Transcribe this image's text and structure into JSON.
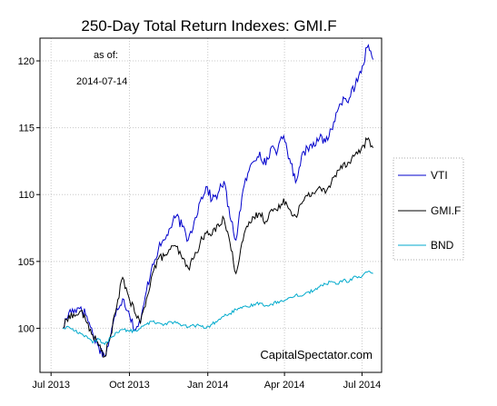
{
  "chart_data": {
    "type": "line",
    "title": "250-Day Total Return Indexes: GMI.F",
    "annotation_label": "as of:",
    "annotation_date": "2014-07-14",
    "source": "CapitalSpectator.com",
    "xlabel": "",
    "ylabel": "",
    "x_ticks": [
      {
        "label": "Jul 2013",
        "date": "2013-07-01"
      },
      {
        "label": "Oct 2013",
        "date": "2013-10-01"
      },
      {
        "label": "Jan 2014",
        "date": "2014-01-01"
      },
      {
        "label": "Apr 2014",
        "date": "2014-04-01"
      },
      {
        "label": "Jul 2014",
        "date": "2014-07-01"
      }
    ],
    "xlim": [
      "2013-06-18",
      "2014-07-24"
    ],
    "y_ticks": [
      100,
      105,
      110,
      115,
      120
    ],
    "ylim": [
      96.7,
      121.7
    ],
    "grid": true,
    "legend_position": "right",
    "series": [
      {
        "name": "VTI",
        "color": "#0000cc",
        "points": [
          [
            "2013-07-15",
            100.0
          ],
          [
            "2013-07-22",
            101.2
          ],
          [
            "2013-07-29",
            101.4
          ],
          [
            "2013-08-05",
            101.6
          ],
          [
            "2013-08-12",
            100.9
          ],
          [
            "2013-08-19",
            99.6
          ],
          [
            "2013-08-26",
            98.6
          ],
          [
            "2013-09-02",
            97.9
          ],
          [
            "2013-09-09",
            99.4
          ],
          [
            "2013-09-16",
            101.5
          ],
          [
            "2013-09-23",
            102.2
          ],
          [
            "2013-09-30",
            101.3
          ],
          [
            "2013-10-07",
            99.9
          ],
          [
            "2013-10-14",
            100.4
          ],
          [
            "2013-10-21",
            102.8
          ],
          [
            "2013-10-28",
            104.8
          ],
          [
            "2013-11-04",
            105.9
          ],
          [
            "2013-11-11",
            106.6
          ],
          [
            "2013-11-18",
            107.5
          ],
          [
            "2013-11-25",
            108.4
          ],
          [
            "2013-12-02",
            107.6
          ],
          [
            "2013-12-09",
            106.6
          ],
          [
            "2013-12-16",
            108.0
          ],
          [
            "2013-12-23",
            109.5
          ],
          [
            "2013-12-30",
            110.6
          ],
          [
            "2014-01-06",
            109.6
          ],
          [
            "2014-01-13",
            110.1
          ],
          [
            "2014-01-20",
            111.0
          ],
          [
            "2014-01-27",
            108.3
          ],
          [
            "2014-02-03",
            106.6
          ],
          [
            "2014-02-10",
            109.8
          ],
          [
            "2014-02-17",
            111.6
          ],
          [
            "2014-02-24",
            112.5
          ],
          [
            "2014-03-03",
            113.2
          ],
          [
            "2014-03-10",
            112.2
          ],
          [
            "2014-03-17",
            113.6
          ],
          [
            "2014-03-24",
            113.3
          ],
          [
            "2014-03-31",
            114.4
          ],
          [
            "2014-04-07",
            112.7
          ],
          [
            "2014-04-14",
            110.9
          ],
          [
            "2014-04-21",
            112.9
          ],
          [
            "2014-04-28",
            113.5
          ],
          [
            "2014-05-05",
            113.9
          ],
          [
            "2014-05-12",
            114.2
          ],
          [
            "2014-05-19",
            113.9
          ],
          [
            "2014-05-26",
            114.9
          ],
          [
            "2014-06-02",
            116.2
          ],
          [
            "2014-06-09",
            117.3
          ],
          [
            "2014-06-16",
            117.2
          ],
          [
            "2014-06-23",
            118.1
          ],
          [
            "2014-06-30",
            119.1
          ],
          [
            "2014-07-07",
            121.0
          ],
          [
            "2014-07-14",
            120.1
          ]
        ]
      },
      {
        "name": "GMI.F",
        "color": "#000000",
        "points": [
          [
            "2013-07-15",
            100.0
          ],
          [
            "2013-07-22",
            101.0
          ],
          [
            "2013-07-29",
            100.9
          ],
          [
            "2013-08-05",
            101.3
          ],
          [
            "2013-08-12",
            100.4
          ],
          [
            "2013-08-19",
            99.5
          ],
          [
            "2013-08-26",
            98.7
          ],
          [
            "2013-09-02",
            97.9
          ],
          [
            "2013-09-09",
            99.5
          ],
          [
            "2013-09-16",
            101.6
          ],
          [
            "2013-09-23",
            103.8
          ],
          [
            "2013-09-30",
            102.4
          ],
          [
            "2013-10-07",
            101.2
          ],
          [
            "2013-10-14",
            100.4
          ],
          [
            "2013-10-21",
            102.2
          ],
          [
            "2013-10-28",
            104.1
          ],
          [
            "2013-11-04",
            105.2
          ],
          [
            "2013-11-11",
            105.4
          ],
          [
            "2013-11-18",
            105.9
          ],
          [
            "2013-11-25",
            106.1
          ],
          [
            "2013-12-02",
            105.2
          ],
          [
            "2013-12-09",
            104.5
          ],
          [
            "2013-12-16",
            105.3
          ],
          [
            "2013-12-23",
            106.4
          ],
          [
            "2013-12-30",
            107.1
          ],
          [
            "2014-01-06",
            107.0
          ],
          [
            "2014-01-13",
            107.8
          ],
          [
            "2014-01-20",
            108.2
          ],
          [
            "2014-01-27",
            106.4
          ],
          [
            "2014-02-03",
            104.1
          ],
          [
            "2014-02-10",
            106.4
          ],
          [
            "2014-02-17",
            107.6
          ],
          [
            "2014-02-24",
            108.3
          ],
          [
            "2014-03-03",
            108.6
          ],
          [
            "2014-03-10",
            108.0
          ],
          [
            "2014-03-17",
            108.9
          ],
          [
            "2014-03-24",
            108.8
          ],
          [
            "2014-03-31",
            109.7
          ],
          [
            "2014-04-07",
            108.9
          ],
          [
            "2014-04-14",
            108.4
          ],
          [
            "2014-04-21",
            109.3
          ],
          [
            "2014-04-28",
            109.9
          ],
          [
            "2014-05-05",
            110.1
          ],
          [
            "2014-05-12",
            110.6
          ],
          [
            "2014-05-19",
            110.1
          ],
          [
            "2014-05-26",
            110.9
          ],
          [
            "2014-06-02",
            111.8
          ],
          [
            "2014-06-09",
            112.3
          ],
          [
            "2014-06-16",
            112.4
          ],
          [
            "2014-06-23",
            113.0
          ],
          [
            "2014-06-30",
            113.4
          ],
          [
            "2014-07-07",
            114.1
          ],
          [
            "2014-07-14",
            113.5
          ]
        ]
      },
      {
        "name": "BND",
        "color": "#00aacc",
        "points": [
          [
            "2013-07-15",
            100.0
          ],
          [
            "2013-07-22",
            100.1
          ],
          [
            "2013-07-29",
            99.8
          ],
          [
            "2013-08-05",
            99.6
          ],
          [
            "2013-08-12",
            99.4
          ],
          [
            "2013-08-19",
            98.9
          ],
          [
            "2013-08-26",
            99.2
          ],
          [
            "2013-09-02",
            98.8
          ],
          [
            "2013-09-09",
            99.3
          ],
          [
            "2013-09-16",
            99.7
          ],
          [
            "2013-09-23",
            99.9
          ],
          [
            "2013-09-30",
            99.8
          ],
          [
            "2013-10-07",
            99.8
          ],
          [
            "2013-10-14",
            100.0
          ],
          [
            "2013-10-21",
            100.3
          ],
          [
            "2013-10-28",
            100.5
          ],
          [
            "2013-11-04",
            100.4
          ],
          [
            "2013-11-11",
            100.3
          ],
          [
            "2013-11-18",
            100.5
          ],
          [
            "2013-11-25",
            100.4
          ],
          [
            "2013-12-02",
            100.2
          ],
          [
            "2013-12-09",
            100.1
          ],
          [
            "2013-12-16",
            100.2
          ],
          [
            "2013-12-23",
            100.2
          ],
          [
            "2013-12-30",
            100.0
          ],
          [
            "2014-01-06",
            100.3
          ],
          [
            "2014-01-13",
            100.6
          ],
          [
            "2014-01-20",
            100.9
          ],
          [
            "2014-01-27",
            101.1
          ],
          [
            "2014-02-03",
            101.4
          ],
          [
            "2014-02-10",
            101.5
          ],
          [
            "2014-02-17",
            101.6
          ],
          [
            "2014-02-24",
            101.8
          ],
          [
            "2014-03-03",
            101.9
          ],
          [
            "2014-03-10",
            101.7
          ],
          [
            "2014-03-17",
            101.8
          ],
          [
            "2014-03-24",
            102.0
          ],
          [
            "2014-03-31",
            102.0
          ],
          [
            "2014-04-07",
            102.3
          ],
          [
            "2014-04-14",
            102.5
          ],
          [
            "2014-04-21",
            102.4
          ],
          [
            "2014-04-28",
            102.7
          ],
          [
            "2014-05-05",
            102.8
          ],
          [
            "2014-05-12",
            103.1
          ],
          [
            "2014-05-19",
            103.3
          ],
          [
            "2014-05-26",
            103.5
          ],
          [
            "2014-06-02",
            103.3
          ],
          [
            "2014-06-09",
            103.6
          ],
          [
            "2014-06-16",
            103.5
          ],
          [
            "2014-06-23",
            103.9
          ],
          [
            "2014-06-30",
            103.8
          ],
          [
            "2014-07-07",
            104.2
          ],
          [
            "2014-07-14",
            104.1
          ]
        ]
      }
    ]
  }
}
